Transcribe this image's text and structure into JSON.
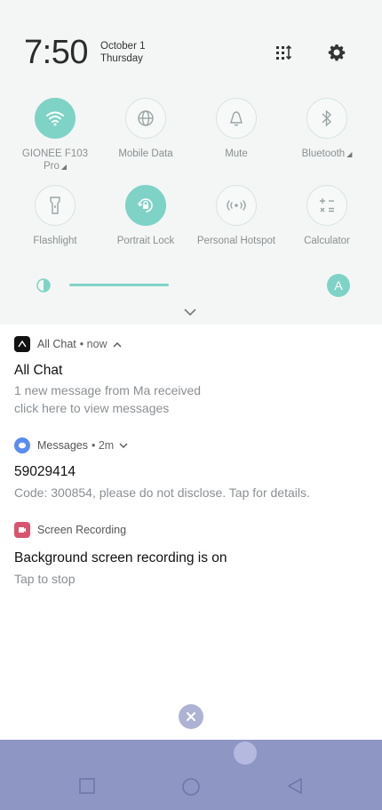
{
  "status": {
    "time": "7:50",
    "date_line1": "October 1",
    "date_line2": "Thursday"
  },
  "quick_tiles": [
    {
      "label": "GIONEE F103 Pro",
      "icon": "wifi-icon",
      "active": true,
      "has_arrow": true
    },
    {
      "label": "Mobile Data",
      "icon": "globe-icon",
      "active": false
    },
    {
      "label": "Mute",
      "icon": "bell-icon",
      "active": false
    },
    {
      "label": "Bluetooth",
      "icon": "bluetooth-icon",
      "active": false,
      "has_arrow": true
    },
    {
      "label": "Flashlight",
      "icon": "flashlight-icon",
      "active": false
    },
    {
      "label": "Portrait Lock",
      "icon": "rotation-lock-icon",
      "active": true
    },
    {
      "label": "Personal Hotspot",
      "icon": "hotspot-icon",
      "active": false
    },
    {
      "label": "Calculator",
      "icon": "calculator-icon",
      "active": false
    }
  ],
  "brightness": {
    "auto_label": "A",
    "level": 0.35
  },
  "notifications": [
    {
      "app": "All Chat",
      "meta": "• now",
      "title": "All Chat",
      "body_line1": "1 new message from Ma received",
      "body_line2": "click here to view messages"
    },
    {
      "app": "Messages",
      "meta": "• 2m",
      "title": "59029414",
      "body_line1": "Code: 300854, please do not disclose. Tap for details."
    },
    {
      "app": "Screen Recording",
      "title": "Background screen recording is on",
      "body_line1": "Tap to stop"
    }
  ],
  "colors": {
    "accent": "#7fd3c6",
    "navbar": "#8e96c4",
    "dismiss": "#aeb3d4"
  }
}
